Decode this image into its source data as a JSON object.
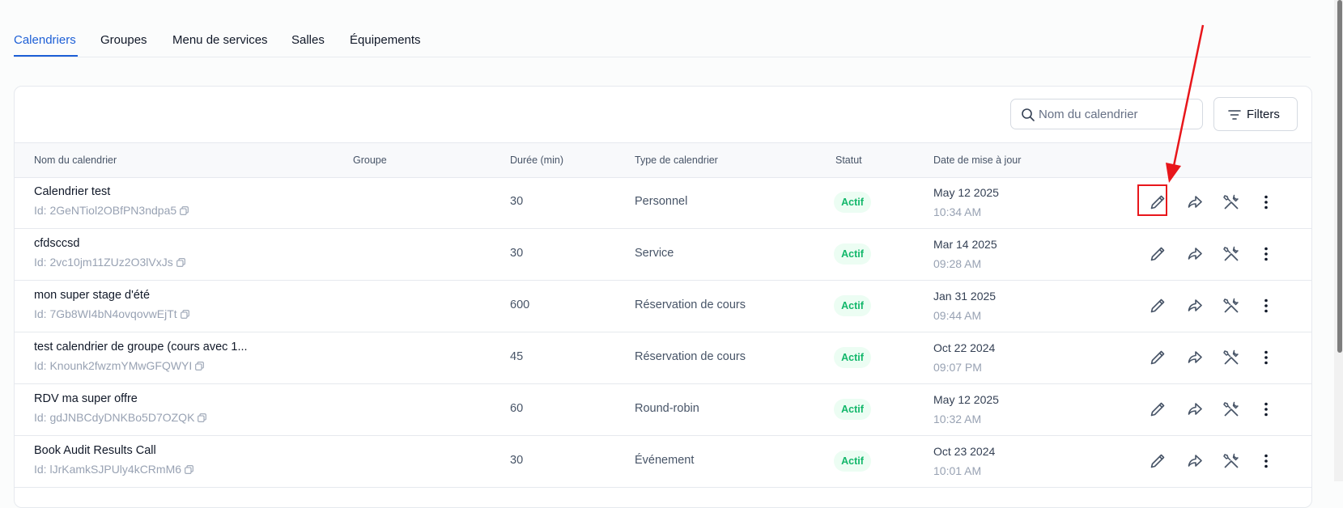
{
  "tabs": [
    {
      "label": "Calendriers",
      "active": true
    },
    {
      "label": "Groupes",
      "active": false
    },
    {
      "label": "Menu de services",
      "active": false
    },
    {
      "label": "Salles",
      "active": false
    },
    {
      "label": "Équipements",
      "active": false
    }
  ],
  "search": {
    "placeholder": "Nom du calendrier",
    "value": ""
  },
  "filters_label": "Filters",
  "columns": {
    "name": "Nom du calendrier",
    "group": "Groupe",
    "duration": "Durée (min)",
    "type": "Type de calendrier",
    "status": "Statut",
    "updated": "Date de mise à jour"
  },
  "rows": [
    {
      "name": "Calendrier test",
      "id": "Id: 2GeNTiol2OBfPN3ndpa5",
      "group": "",
      "duration": "30",
      "type": "Personnel",
      "status": "Actif",
      "date": "May 12 2025",
      "time": "10:34 AM"
    },
    {
      "name": "cfdsccsd",
      "id": "Id: 2vc10jm11ZUz2O3lVxJs",
      "group": "",
      "duration": "30",
      "type": "Service",
      "status": "Actif",
      "date": "Mar 14 2025",
      "time": "09:28 AM"
    },
    {
      "name": "mon super stage d'été",
      "id": "Id: 7Gb8WI4bN4ovqovwEjTt",
      "group": "",
      "duration": "600",
      "type": "Réservation de cours",
      "status": "Actif",
      "date": "Jan 31 2025",
      "time": "09:44 AM"
    },
    {
      "name": "test calendrier de groupe (cours avec 1...",
      "id": "Id: Knounk2fwzmYMwGFQWYI",
      "group": "",
      "duration": "45",
      "type": "Réservation de cours",
      "status": "Actif",
      "date": "Oct 22 2024",
      "time": "09:07 PM"
    },
    {
      "name": "RDV ma super offre",
      "id": "Id: gdJNBCdyDNKBo5D7OZQK",
      "group": "",
      "duration": "60",
      "type": "Round-robin",
      "status": "Actif",
      "date": "May 12 2025",
      "time": "10:32 AM"
    },
    {
      "name": "Book Audit Results Call",
      "id": "Id: lJrKamkSJPUly4kCRmM6",
      "group": "",
      "duration": "30",
      "type": "Événement",
      "status": "Actif",
      "date": "Oct 23 2024",
      "time": "10:01 AM"
    }
  ],
  "row_actions": [
    "pencil-icon",
    "share-icon",
    "tools-icon",
    "more-vertical-icon"
  ],
  "colors": {
    "accent": "#1d5fd6",
    "status_bg": "#ecfdf3",
    "status_text": "#12b76a",
    "annotation": "#e8161b"
  }
}
